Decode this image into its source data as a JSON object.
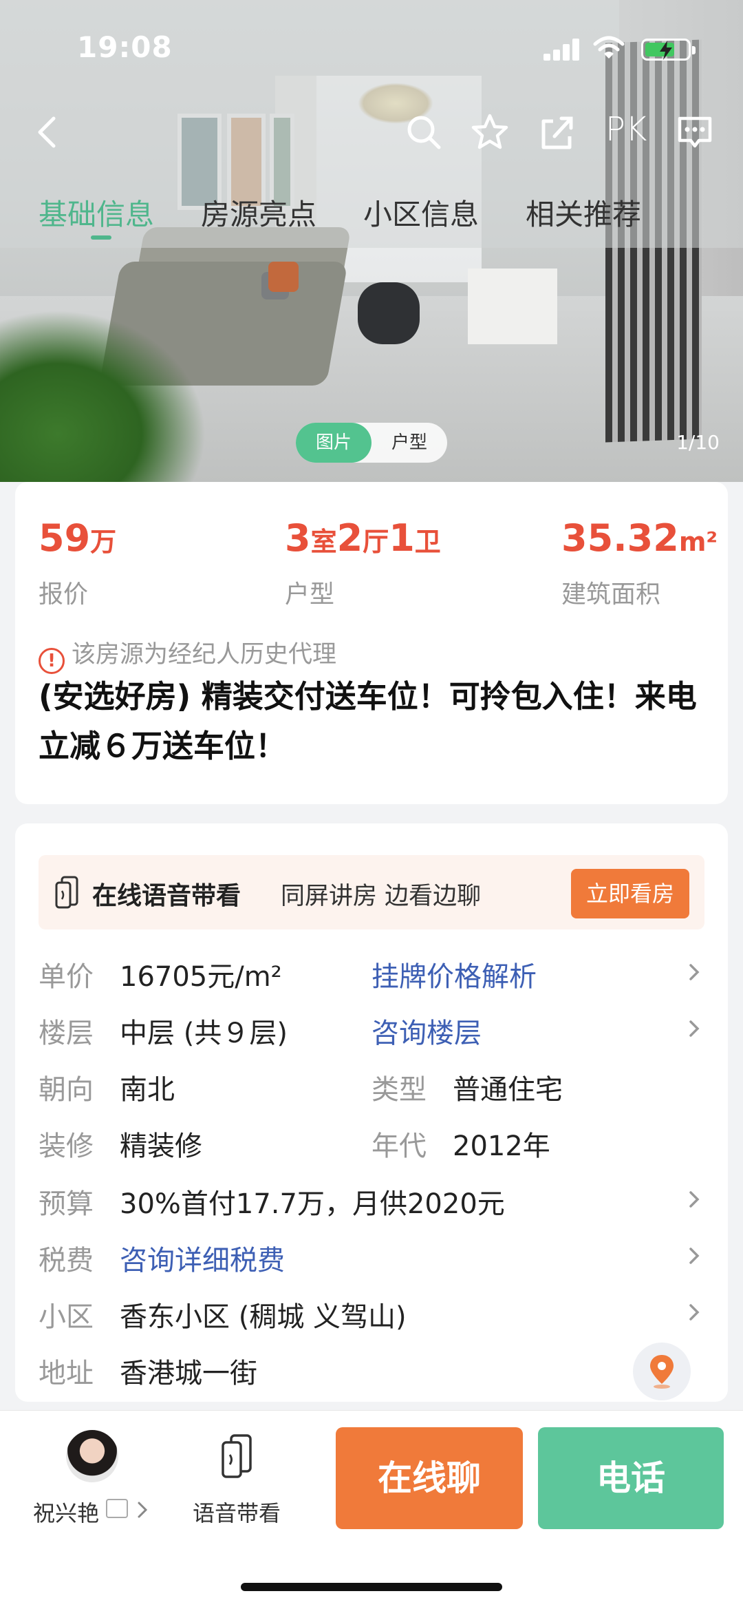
{
  "status_bar": {
    "time": "19:08"
  },
  "nav": {
    "pk_label": "PK"
  },
  "tabs": [
    {
      "label": "基础信息"
    },
    {
      "label": "房源亮点"
    },
    {
      "label": "小区信息"
    },
    {
      "label": "相关推荐"
    }
  ],
  "media": {
    "photo_label": "图片",
    "floorplan_label": "户型",
    "counter": "1/10"
  },
  "summary": {
    "price_value": "59",
    "price_unit": "万",
    "price_label": "报价",
    "layout_room_num": "3",
    "layout_room_unit": "室",
    "layout_hall_num": "2",
    "layout_hall_unit": "厅",
    "layout_bath_num": "1",
    "layout_bath_unit": "卫",
    "layout_label": "户型",
    "area_value": "35.32",
    "area_unit": "m²",
    "area_label": "建筑面积",
    "notice": "该房源为经纪人历史代理",
    "title": "(安选好房) 精装交付送车位！可拎包入住！来电立减６万送车位！"
  },
  "voice_banner": {
    "title": "在线语音带看",
    "subtitle": "同屏讲房 边看边聊",
    "button": "立即看房"
  },
  "details": {
    "unit_price_label": "单价",
    "unit_price_value": "16705元/m²",
    "price_analysis_link": "挂牌价格解析",
    "floor_label": "楼层",
    "floor_value": "中层 (共９层)",
    "floor_link": "咨询楼层",
    "orientation_label": "朝向",
    "orientation_value": "南北",
    "type_label": "类型",
    "type_value": "普通住宅",
    "decoration_label": "装修",
    "decoration_value": "精装修",
    "year_label": "年代",
    "year_value": "2012年",
    "budget_label": "预算",
    "budget_value": "30%首付17.7万，月供2020元",
    "tax_label": "税费",
    "tax_link": "咨询详细税费",
    "community_label": "小区",
    "community_value": "香东小区 (稠城 义驾山)",
    "address_label": "地址",
    "address_value": "香港城一街"
  },
  "bottom_bar": {
    "agent_name": "祝兴艳",
    "voice_label": "语音带看",
    "chat_button": "在线聊",
    "call_button": "电话"
  },
  "colors": {
    "accent_green": "#4fb68c",
    "price_red": "#e8503a",
    "orange": "#f07a3a",
    "link_blue": "#3d5fb4"
  }
}
